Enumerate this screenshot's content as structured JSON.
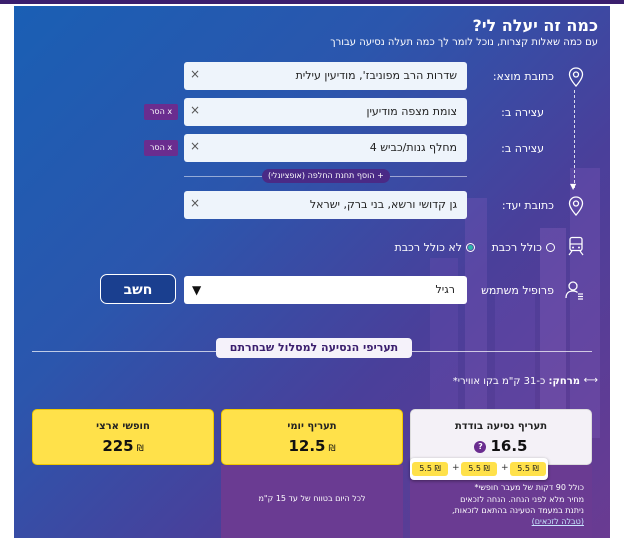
{
  "header": {
    "title": "כמה זה יעלה לי?",
    "subtitle": "עם כמה שאלות קצרות, נוכל לומר לך כמה תעלה נסיעה עבורך"
  },
  "form": {
    "origin": {
      "label": "כתובת מוצא:",
      "value": "שדרות הרב מפוניבז', מודיעין עילית"
    },
    "stops": [
      {
        "label": "עצירה ב:",
        "value": "צומת מצפה מודיעין",
        "remove_label": "x הסר"
      },
      {
        "label": "עצירה ב:",
        "value": "מחלף גנות/כביש 4",
        "remove_label": "x הסר"
      }
    ],
    "add_stop_label": "+ הוסף תחנת החלפה (אופציונלי)",
    "destination": {
      "label": "כתובת יעד:",
      "value": "גן קדושי ורשא, בני ברק, ישראל"
    },
    "clear_symbol": "×",
    "train_options": [
      {
        "label": "כולל רכבת",
        "selected": false
      },
      {
        "label": "לא כולל רכבת",
        "selected": true
      }
    ],
    "profile": {
      "label": "פרופיל משתמש",
      "value": "רגיל"
    },
    "calculate_label": "חשב"
  },
  "results": {
    "section_title": "תעריפי הנסיעה למסלול שבחרתם",
    "route_prefix": "מרחק:",
    "route_text": "כ-31 ק\"מ בקו אווירי*",
    "currency": "₪",
    "cards": [
      {
        "title": "תעריף נסיעה בודדת",
        "value": "16.5"
      },
      {
        "title": "תעריף יומי",
        "value": "12.5",
        "note": "לכל היום בטווח של עד 15 ק\"מ"
      },
      {
        "title": "חופשי ארצי",
        "value": "225"
      }
    ],
    "breakdown": [
      "5.5 ₪",
      "5.5 ₪",
      "5.5 ₪"
    ],
    "breakdown_plus": "+",
    "single_note_lines": [
      "כולל 90 דקות של מעבר חופשי*",
      "מחיר מלא לפני הנחה. הנחה לזכאים",
      "ניתנת במעמד הטעינה בהתאם לזכאות,"
    ],
    "single_note_link": "(טבלה לזכאים)",
    "help_symbol": "?"
  },
  "icons": {
    "pin": "map-pin-icon",
    "train": "train-icon",
    "user": "user-profile-icon",
    "dropdown": "dropdown-triangle-icon",
    "distance": "distance-arrow-icon"
  },
  "colors": {
    "gradient_start": "#1a5fb4",
    "gradient_end": "#6a3b92",
    "yellow_card": "#ffe14a",
    "purple_accent": "#6a2d8f"
  }
}
